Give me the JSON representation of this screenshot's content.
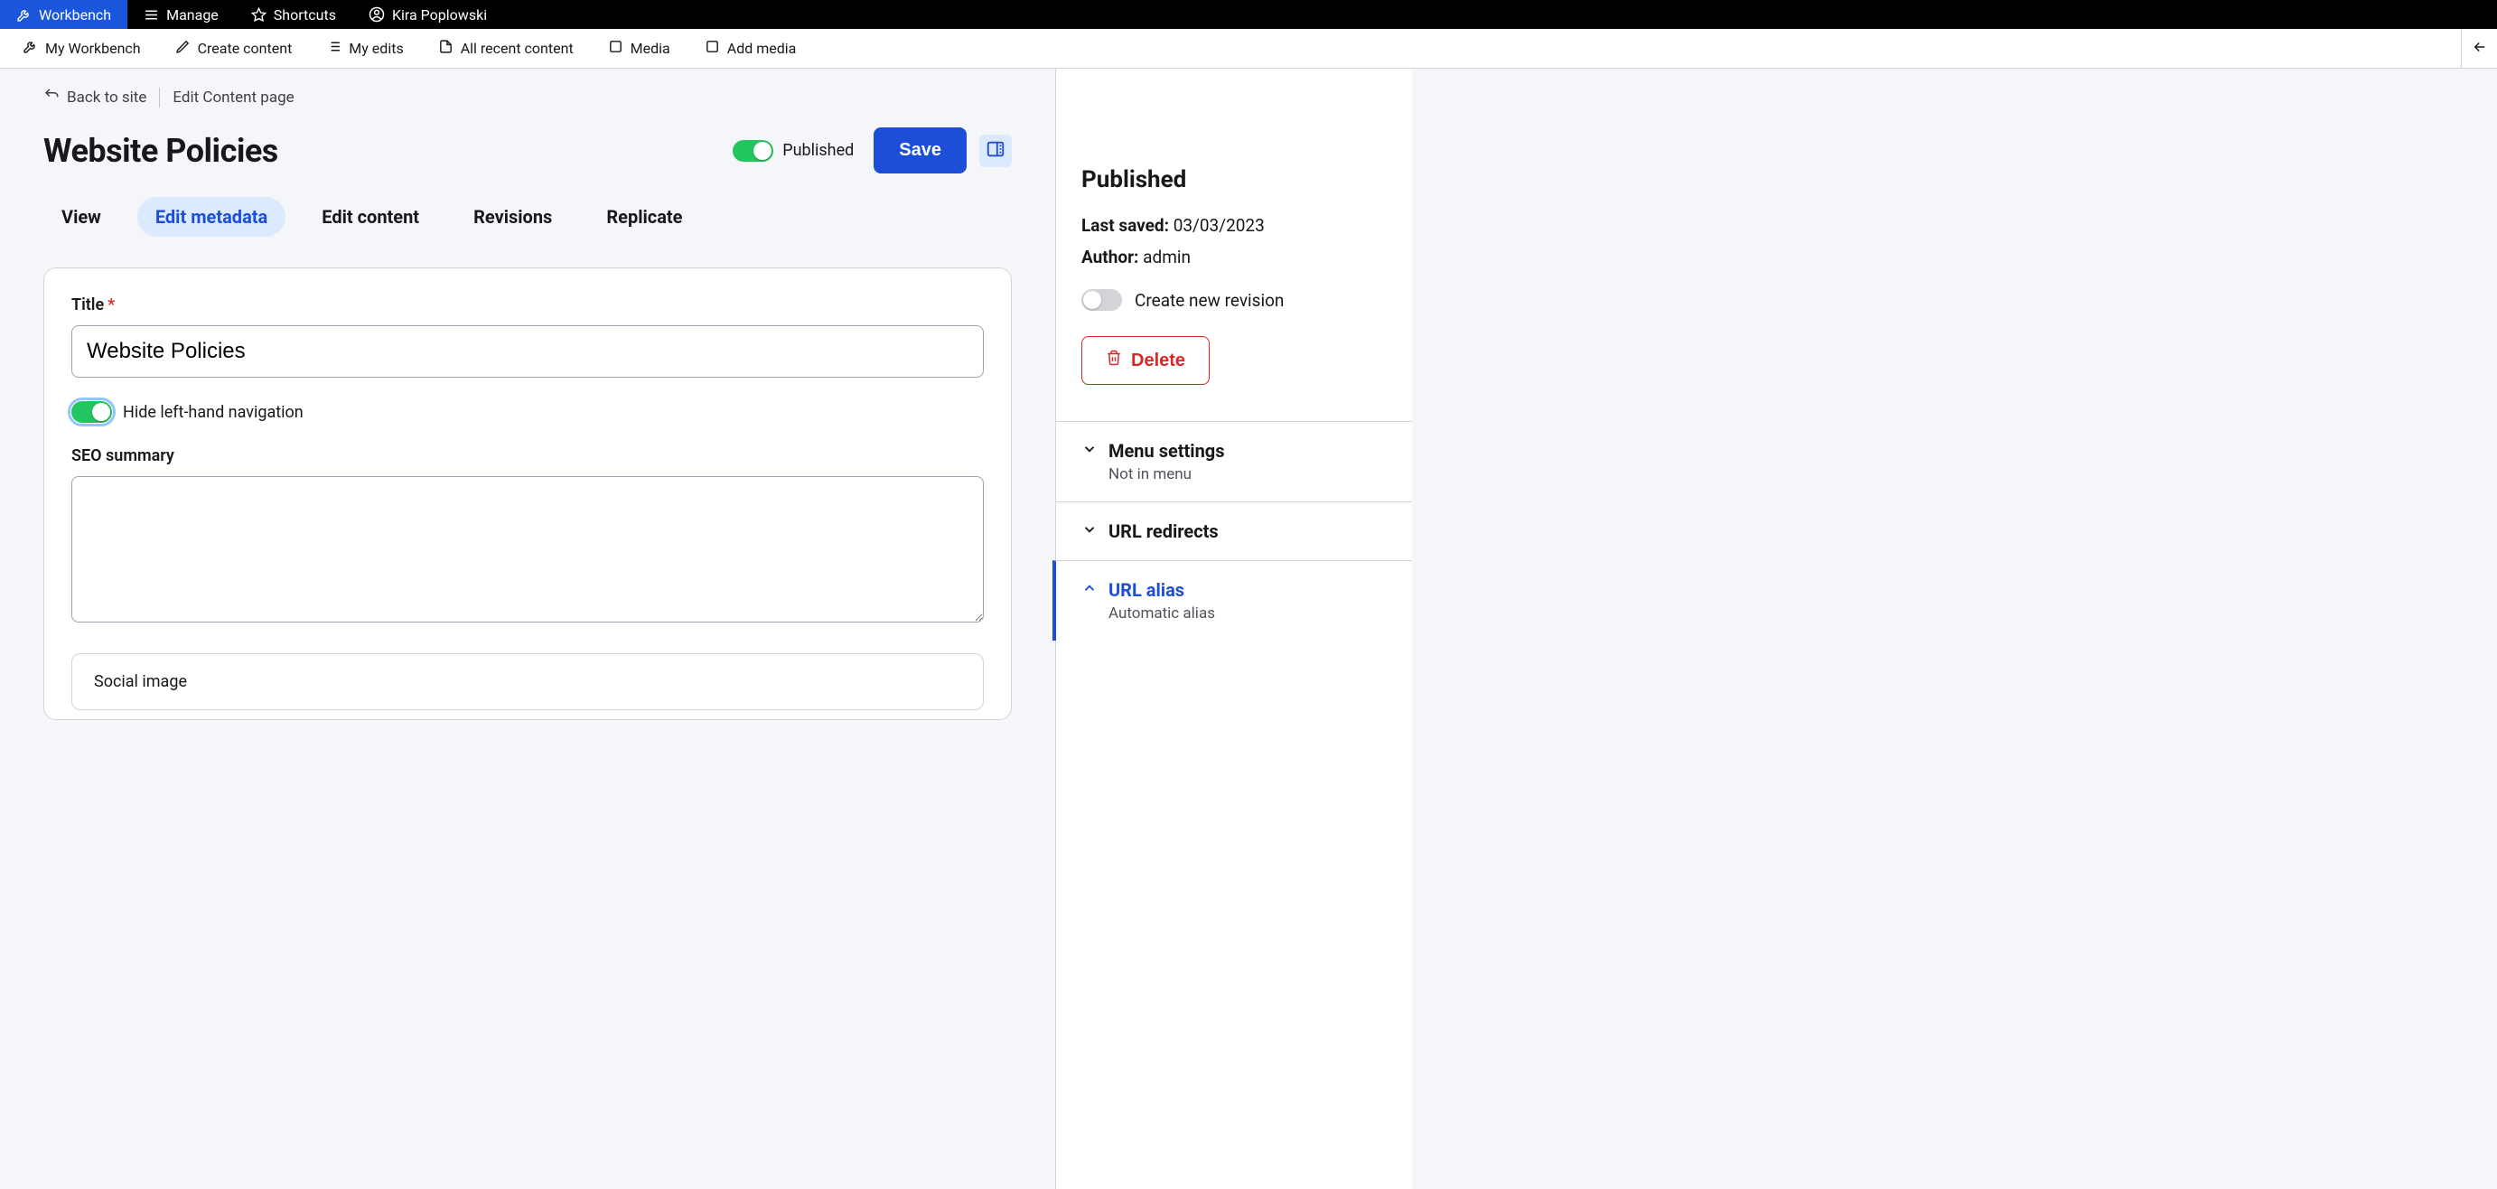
{
  "topbar": {
    "workbench": "Workbench",
    "manage": "Manage",
    "shortcuts": "Shortcuts",
    "user": "Kira Poplowski"
  },
  "secbar": {
    "my_workbench": "My Workbench",
    "create_content": "Create content",
    "my_edits": "My edits",
    "all_recent": "All recent content",
    "media": "Media",
    "add_media": "Add media"
  },
  "crumbs": {
    "back": "Back to site",
    "current": "Edit Content page"
  },
  "page_title": "Website Policies",
  "published_label": "Published",
  "save_label": "Save",
  "tabs": {
    "view": "View",
    "edit_metadata": "Edit metadata",
    "edit_content": "Edit content",
    "revisions": "Revisions",
    "replicate": "Replicate"
  },
  "form": {
    "title_label": "Title",
    "title_value": "Website Policies",
    "hide_nav_label": "Hide left-hand navigation",
    "seo_label": "SEO summary",
    "seo_value": "",
    "social_image_label": "Social image"
  },
  "side": {
    "status": "Published",
    "last_saved_label": "Last saved:",
    "last_saved_value": "03/03/2023",
    "author_label": "Author:",
    "author_value": "admin",
    "create_revision_label": "Create new revision",
    "delete_label": "Delete",
    "menu_settings": "Menu settings",
    "menu_settings_sub": "Not in menu",
    "url_redirects": "URL redirects",
    "url_alias": "URL alias",
    "url_alias_sub": "Automatic alias"
  }
}
